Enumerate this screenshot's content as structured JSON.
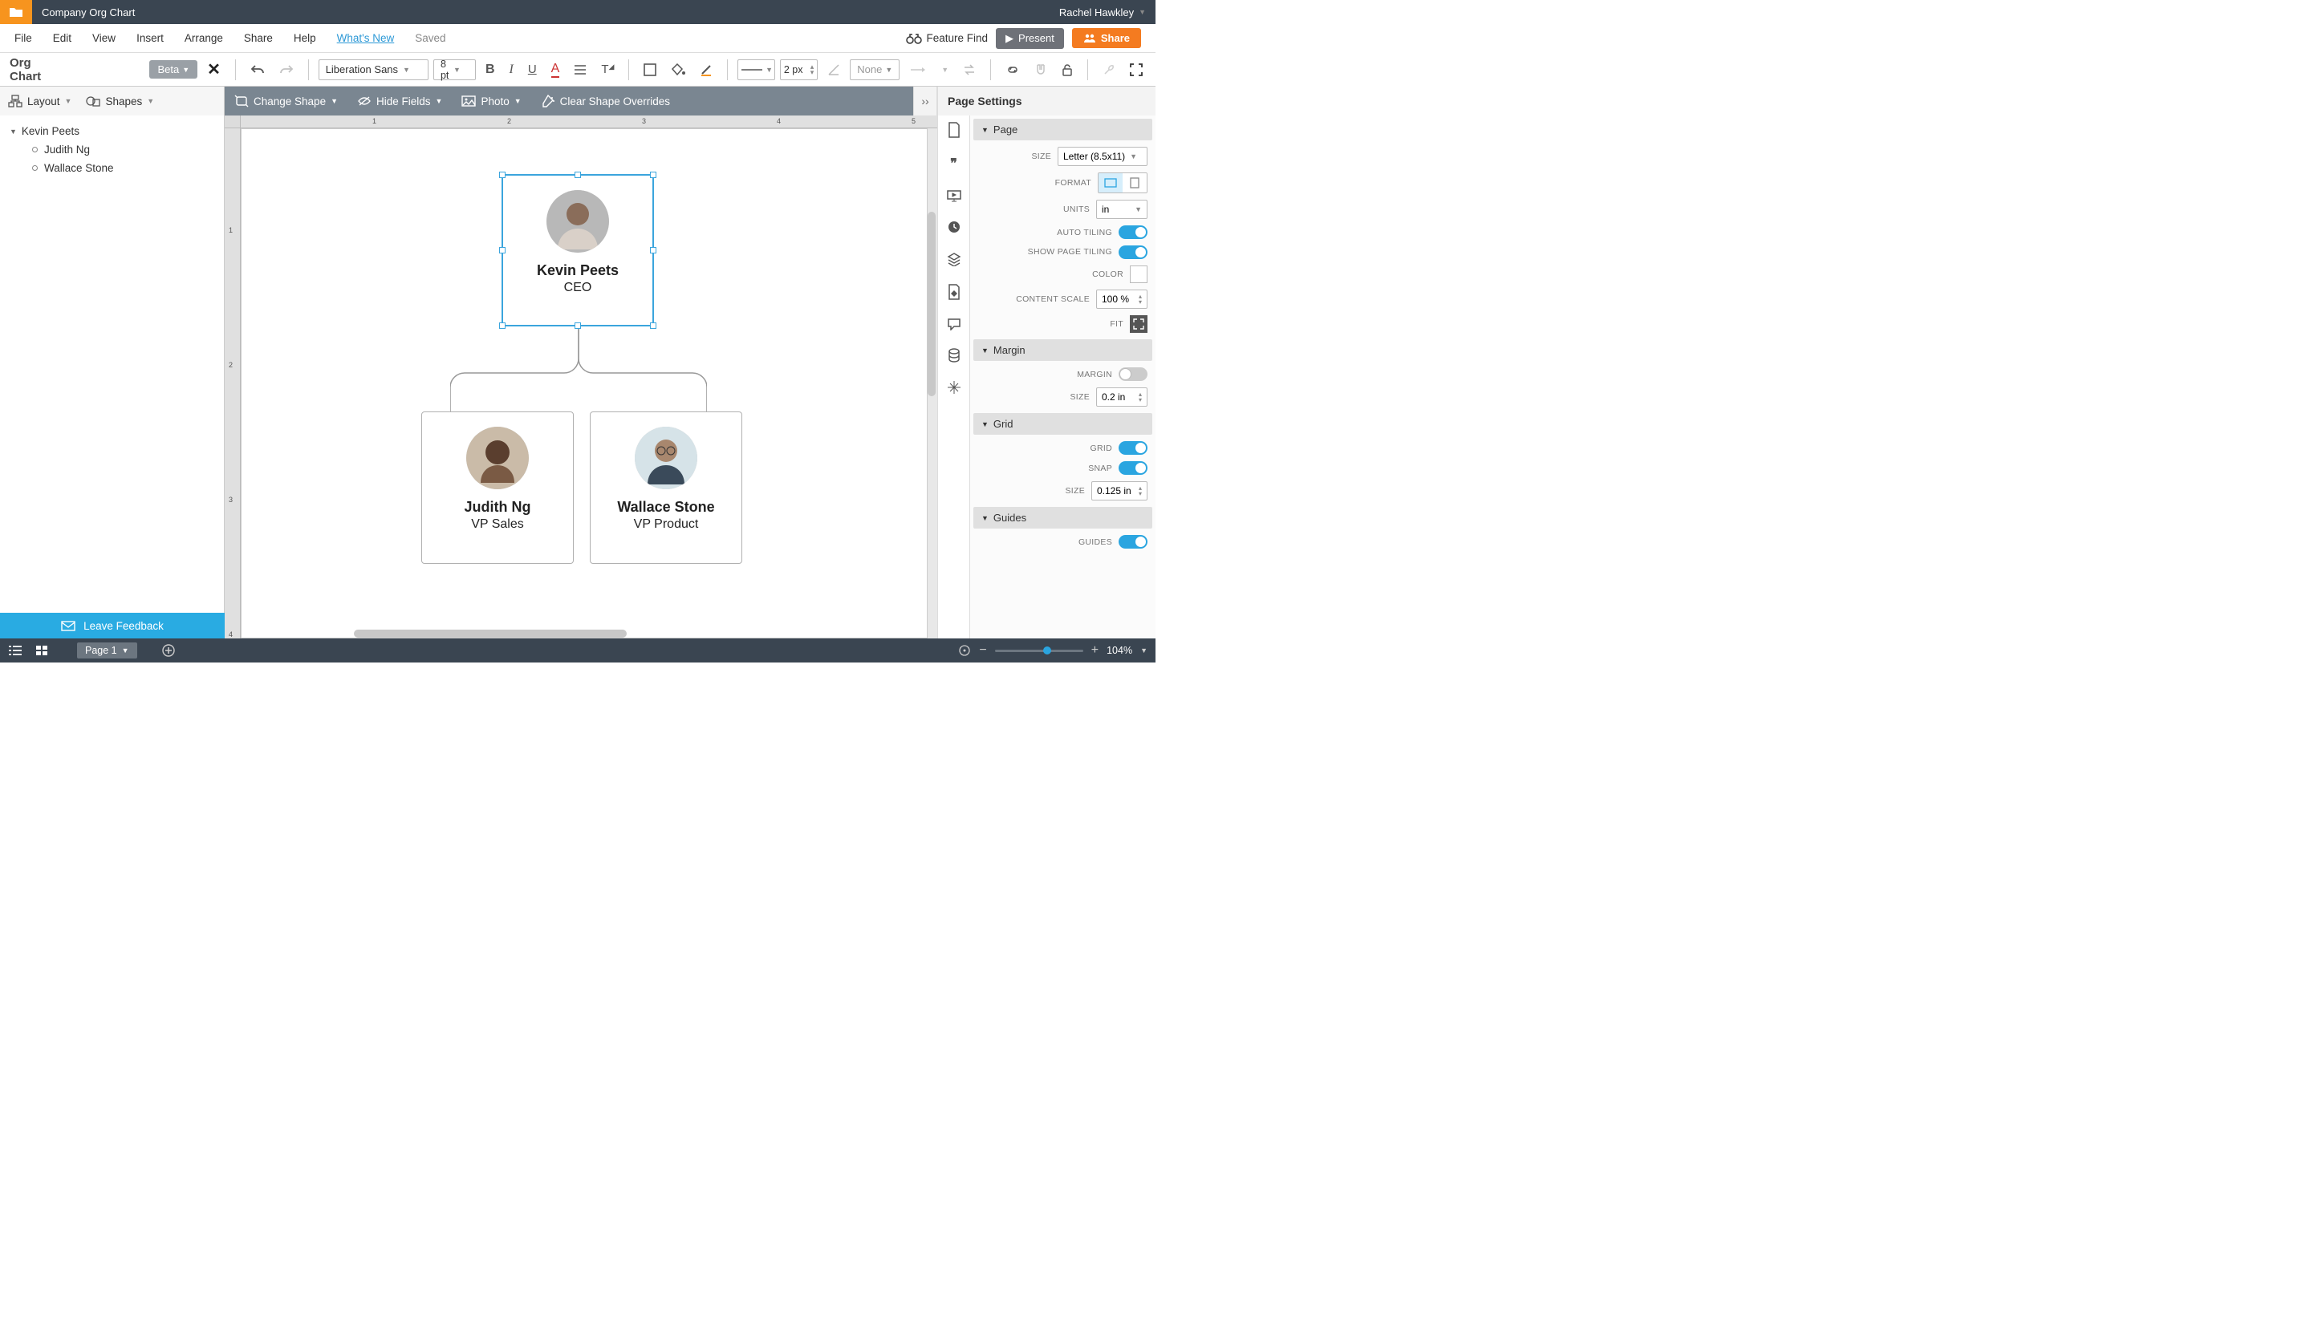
{
  "titlebar": {
    "doc_title": "Company Org Chart",
    "user": "Rachel Hawkley"
  },
  "menubar": {
    "items": [
      "File",
      "Edit",
      "View",
      "Insert",
      "Arrange",
      "Share",
      "Help"
    ],
    "whatsnew": "What's New",
    "saved": "Saved",
    "feature_find": "Feature Find",
    "present": "Present",
    "share": "Share"
  },
  "toolbar": {
    "panel_label": "Org Chart",
    "beta": "Beta",
    "font": "Liberation Sans",
    "font_size": "8 pt",
    "line_width": "2 px",
    "shape_none": "None"
  },
  "secondbar": {
    "layout": "Layout",
    "shapes": "Shapes",
    "change_shape": "Change Shape",
    "hide_fields": "Hide Fields",
    "photo": "Photo",
    "clear_overrides": "Clear Shape Overrides",
    "page_settings": "Page Settings"
  },
  "tree": {
    "root": "Kevin Peets",
    "children": [
      "Judith Ng",
      "Wallace Stone"
    ]
  },
  "feedback": "Leave Feedback",
  "cards": {
    "ceo": {
      "name": "Kevin Peets",
      "role": "CEO"
    },
    "vp_sales": {
      "name": "Judith Ng",
      "role": "VP Sales"
    },
    "vp_product": {
      "name": "Wallace Stone",
      "role": "VP Product"
    }
  },
  "ruler": {
    "h": [
      "1",
      "2",
      "3",
      "4",
      "5"
    ],
    "v": [
      "1",
      "2",
      "3",
      "4"
    ]
  },
  "page_settings": {
    "sections": {
      "page": "Page",
      "margin": "Margin",
      "grid": "Grid",
      "guides": "Guides"
    },
    "size_label": "SIZE",
    "size_value": "Letter (8.5x11)",
    "format_label": "FORMAT",
    "units_label": "UNITS",
    "units_value": "in",
    "auto_tiling_label": "AUTO TILING",
    "show_tiling_label": "SHOW PAGE TILING",
    "color_label": "COLOR",
    "content_scale_label": "CONTENT SCALE",
    "content_scale_value": "100 %",
    "fit_label": "FIT",
    "margin_label": "MARGIN",
    "margin_size_label": "SIZE",
    "margin_size_value": "0.2 in",
    "grid_label": "GRID",
    "snap_label": "SNAP",
    "grid_size_label": "SIZE",
    "grid_size_value": "0.125 in",
    "guides_label": "GUIDES"
  },
  "bottombar": {
    "page_tab": "Page 1",
    "zoom": "104%"
  }
}
